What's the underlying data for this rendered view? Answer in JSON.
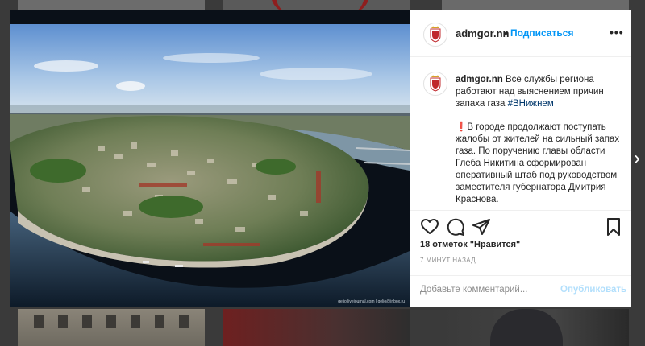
{
  "header": {
    "username": "admgor.nn",
    "dot": "•",
    "follow_label": "Подписаться",
    "more_icon": "more-horizontal-icon"
  },
  "caption": {
    "username": "admgor.nn",
    "text": "Все службы региона работают над выяснением причин запаха газа",
    "hashtag": "#ВНижнем",
    "paragraph2_marker": "❗",
    "paragraph2": "В городе продолжают поступать жалобы от жителей на сильный запах газа. По поручению главы области Глеба Никитина сформирован оперативный штаб под руководством заместителя губернатора Дмитрия Краснова."
  },
  "actions": {
    "icons": [
      "heart-icon",
      "comment-icon",
      "share-icon",
      "bookmark-icon"
    ]
  },
  "likes_text": "18 отметок \"Нравится\"",
  "timestamp": "7 МИНУТ НАЗАД",
  "comment_box": {
    "placeholder": "Добавьте комментарий...",
    "post_label": "Опубликовать"
  },
  "photo": {
    "watermark": "gelio.livejournal.com   |   gelio@inbox.ru"
  },
  "colors": {
    "accent": "#0095f6",
    "post_disabled": "#b2dffc",
    "text": "#262626",
    "muted": "#8e8e8e"
  },
  "nav": {
    "next_icon": "chevron-right-icon",
    "next_glyph": "›"
  }
}
